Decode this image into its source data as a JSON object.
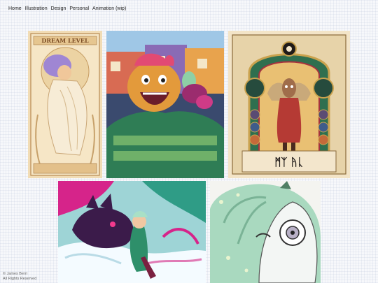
{
  "nav": {
    "items": [
      {
        "label": "Home"
      },
      {
        "label": "Illustration"
      },
      {
        "label": "Design"
      },
      {
        "label": "Personal"
      },
      {
        "label": "Animation (wip)"
      }
    ]
  },
  "gallery": {
    "art_nouveau_banner": "DREAM LEVEL",
    "tarot_glyphs": "ᛗᛉ ᚤᚳ"
  },
  "footer": {
    "copyright": "© James Berri",
    "rights": "All Rights Reserved"
  }
}
